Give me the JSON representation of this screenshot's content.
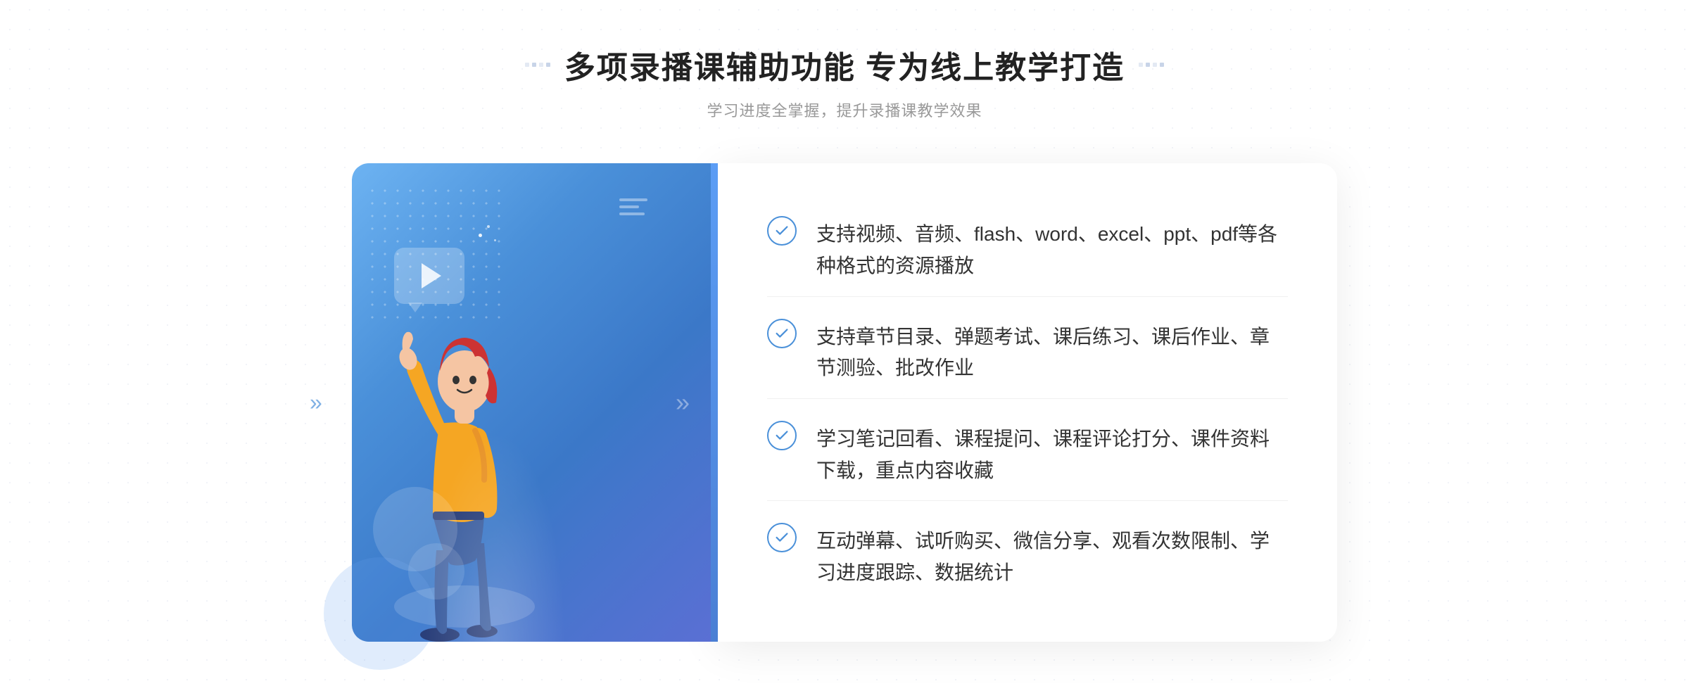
{
  "header": {
    "title": "多项录播课辅助功能 专为线上教学打造",
    "subtitle": "学习进度全掌握，提升录播课教学效果",
    "deco_dots": [
      "·",
      "·",
      "·",
      "·"
    ]
  },
  "features": [
    {
      "id": 1,
      "text": "支持视频、音频、flash、word、excel、ppt、pdf等各种格式的资源播放"
    },
    {
      "id": 2,
      "text": "支持章节目录、弹题考试、课后练习、课后作业、章节测验、批改作业"
    },
    {
      "id": 3,
      "text": "学习笔记回看、课程提问、课程评论打分、课件资料下载，重点内容收藏"
    },
    {
      "id": 4,
      "text": "互动弹幕、试听购买、微信分享、观看次数限制、学习进度跟踪、数据统计"
    }
  ],
  "colors": {
    "primary_blue": "#4a90d9",
    "light_blue": "#6db3f2",
    "dark_blue": "#3b78c8",
    "text_dark": "#333333",
    "text_gray": "#999999",
    "border_light": "#f0f0f0"
  }
}
